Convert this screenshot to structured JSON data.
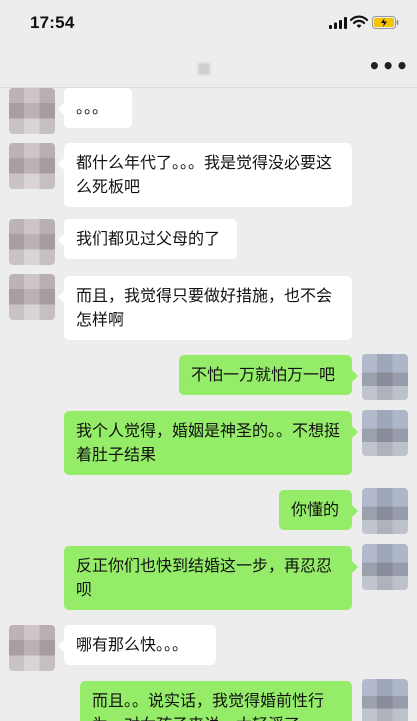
{
  "status_bar": {
    "time": "17:54",
    "icons": [
      "signal-icon",
      "wifi-icon",
      "battery-charging-icon"
    ],
    "battery_color": "#f5c400"
  },
  "nav_bar": {
    "title_blurred": true,
    "more_label": "•••"
  },
  "colors": {
    "background": "#ededed",
    "incoming_bubble": "#ffffff",
    "outgoing_bubble": "#95ec69"
  },
  "messages": [
    {
      "side": "left",
      "text": "。。。"
    },
    {
      "side": "left",
      "text": "都什么年代了。。。我是觉得没必要这么死板吧"
    },
    {
      "side": "left",
      "text": "我们都见过父母的了"
    },
    {
      "side": "left",
      "text": "而且，我觉得只要做好措施，也不会怎样啊"
    },
    {
      "side": "right",
      "text": "不怕一万就怕万一吧"
    },
    {
      "side": "right",
      "text": "我个人觉得，婚姻是神圣的。。不想挺着肚子结果"
    },
    {
      "side": "right",
      "text": "你懂的"
    },
    {
      "side": "right",
      "text": "反正你们也快到结婚这一步，再忍忍呗"
    },
    {
      "side": "left",
      "text": "哪有那么快。。。"
    },
    {
      "side": "right",
      "text": "而且。。说实话，我觉得婚前性行为，对女孩子来说，太轻浮了"
    }
  ]
}
